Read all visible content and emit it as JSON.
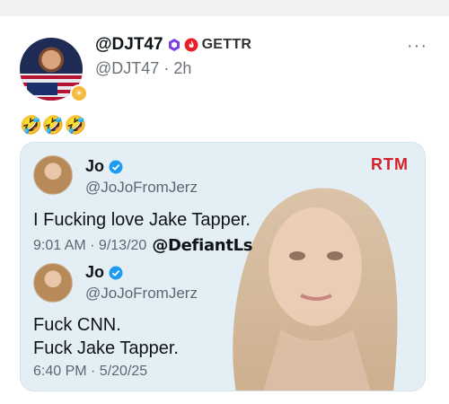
{
  "post": {
    "display_name": "@DJT47",
    "platform_name": "GETTR",
    "handle": "@DJT47",
    "age": "2h",
    "meta_separator": "·",
    "more_label": "···",
    "text": "🤣🤣🤣"
  },
  "embed": {
    "logo_text": "RTM",
    "first_tweet": {
      "name": "Jo",
      "handle": "@JoJoFromJerz",
      "text": "I Fucking love Jake Tapper.",
      "timestamp": "9:01 AM · 9/13/20",
      "credit": "@DefiantLs"
    },
    "second_tweet": {
      "name": "Jo",
      "handle": "@JoJoFromJerz",
      "text": "Fuck CNN.\nFuck Jake Tapper.",
      "timestamp": "6:40 PM · 5/20/25"
    }
  },
  "colors": {
    "accent_blue": "#1d9bf0",
    "rtm_red": "#d6202a",
    "embed_bg": "#e4eff5",
    "muted_text": "#6b7178"
  },
  "icons": {
    "badge_icon": "hexagon-badge-icon",
    "flame_icon": "flame-icon",
    "verified_icon": "verified-check-icon"
  }
}
